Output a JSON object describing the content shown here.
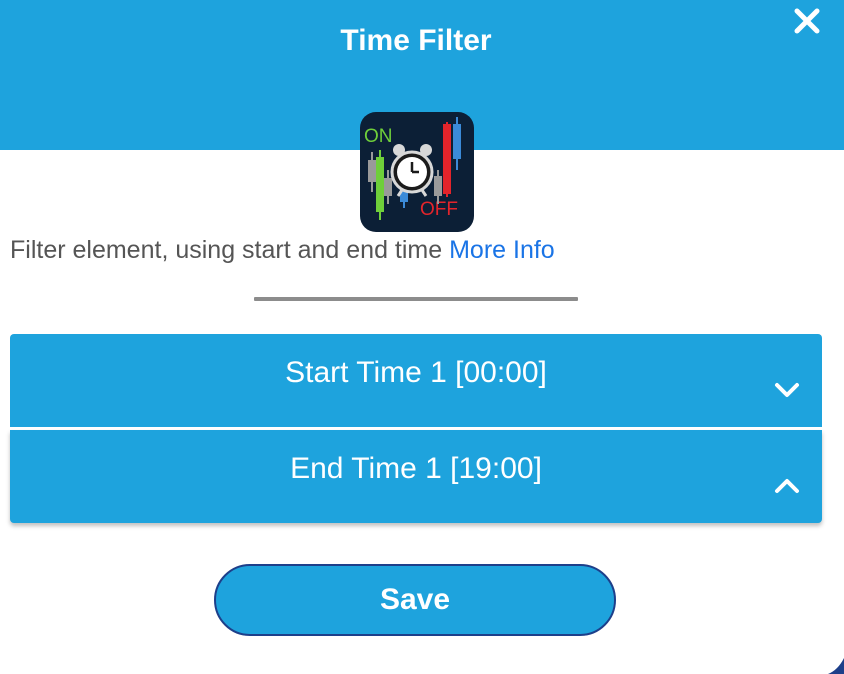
{
  "dialog": {
    "title": "Time Filter",
    "close_icon": "close-icon"
  },
  "app_icon": {
    "on_label": "ON",
    "off_label": "OFF",
    "icon": "alarm-clock-candlestick-icon"
  },
  "description": {
    "text": "Filter element, using start and end time ",
    "link_text": "More Info"
  },
  "panels": [
    {
      "label": "Start Time 1 [00:00]",
      "chevron": "chevron-down-icon"
    },
    {
      "label": "End Time 1 [19:00]",
      "chevron": "chevron-up-icon"
    }
  ],
  "save_button": {
    "label": "Save"
  },
  "colors": {
    "accent": "#1ea3dd",
    "link": "#1a74e6",
    "text": "#555555",
    "save_border": "#1d3f8a"
  }
}
